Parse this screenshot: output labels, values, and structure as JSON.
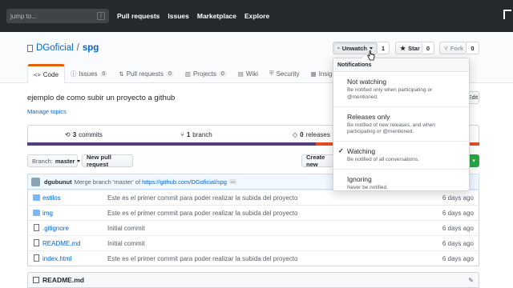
{
  "header": {
    "search_placeholder": "jump to...",
    "nav": [
      "Pull requests",
      "Issues",
      "Marketplace",
      "Explore"
    ]
  },
  "repo": {
    "owner": "DGoficial",
    "separator": "/",
    "name": "spg",
    "unwatch_label": "Unwatch",
    "watch_count": "1",
    "star_label": "Star",
    "star_count": "0",
    "fork_label": "Fork",
    "fork_count": "0"
  },
  "tabs": [
    {
      "label": "Code",
      "icon": "code-icon",
      "count": ""
    },
    {
      "label": "Issues",
      "icon": "issue-icon",
      "count": "0"
    },
    {
      "label": "Pull requests",
      "icon": "pull-request-icon",
      "count": "0"
    },
    {
      "label": "Projects",
      "icon": "project-icon",
      "count": "0"
    },
    {
      "label": "Wiki",
      "icon": "wiki-icon",
      "count": ""
    },
    {
      "label": "Security",
      "icon": "shield-icon",
      "count": ""
    },
    {
      "label": "Insigh",
      "icon": "graph-icon",
      "count": ""
    }
  ],
  "description": "ejemplo de como subir un proyecto a github",
  "manage_topics": "Manage topics",
  "edit_label": "Edit",
  "summary": {
    "commits_num": "3",
    "commits_label": "commits",
    "branch_num": "1",
    "branch_label": "branch",
    "releases_num": "0",
    "releases_label": "releases"
  },
  "colors": {
    "accent": "#0366d6",
    "header_bg": "#24292e",
    "tab_highlight": "#e36209",
    "lang_css": "#563d7c",
    "lang_html": "#e34c26",
    "clone_green": "#28a745"
  },
  "file_nav": {
    "branch_prefix": "Branch:",
    "branch": "master",
    "new_pr": "New pull request",
    "create_new": "Create new"
  },
  "latest_commit": {
    "author": "dgubunut",
    "message": "Merge branch 'master' of",
    "link": "https://github.com/DGoficial/spg",
    "ellipsis": "..."
  },
  "files": [
    {
      "type": "dir",
      "name": "estilos",
      "message": "Este es el primer commit para poder realizar la subida del proyecto",
      "age": "6 days ago"
    },
    {
      "type": "dir",
      "name": "img",
      "message": "Este es el primer commit para poder realizar la subida del proyecto",
      "age": "6 days ago"
    },
    {
      "type": "file",
      "name": ".gitignore",
      "message": "Initial commit",
      "age": "6 days ago"
    },
    {
      "type": "file",
      "name": "README.md",
      "message": "Initial commit",
      "age": "6 days ago"
    },
    {
      "type": "file",
      "name": "index.html",
      "message": "Este es el primer commit para poder realizar la subida del proyecto",
      "age": "6 days ago"
    }
  ],
  "readme_title": "README.md",
  "notifications": {
    "header": "Notifications",
    "items": [
      {
        "title": "Not watching",
        "desc": "Be notified only when participating or @mentioned.",
        "checked": false
      },
      {
        "title": "Releases only",
        "desc": "Be notified of new releases, and when participating or @mentioned.",
        "checked": false
      },
      {
        "title": "Watching",
        "desc": "Be notified of all conversations.",
        "checked": true
      },
      {
        "title": "Ignoring",
        "desc": "Never be notified.",
        "checked": false
      }
    ]
  }
}
